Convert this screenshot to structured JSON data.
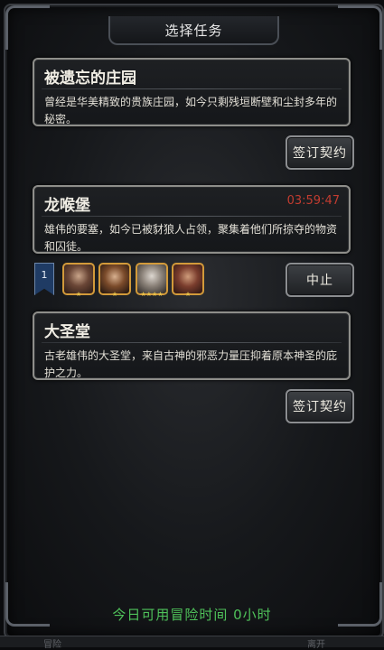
{
  "header": {
    "title": "选择任务"
  },
  "quests": [
    {
      "name": "被遗忘的庄园",
      "description": "曾经是华美精致的贵族庄园，如今只剩残垣断壁和尘封多年的秘密。",
      "button": "签订契约"
    },
    {
      "name": "龙喉堡",
      "timer": "03:59:47",
      "description": "雄伟的要塞，如今已被豺狼人占领，聚集着他们所掠夺的物资和囚徒。",
      "button": "中止",
      "party": {
        "rank": "1",
        "heroes": [
          {
            "stars": "★"
          },
          {
            "stars": "★"
          },
          {
            "stars": "★★★★"
          },
          {
            "stars": "★"
          }
        ]
      }
    },
    {
      "name": "大圣堂",
      "description": "古老雄伟的大圣堂，来自古神的邪恶力量压抑着原本神圣的庇护之力。",
      "button": "签订契约"
    }
  ],
  "footer": {
    "text": "今日可用冒险时间 0小时"
  },
  "bottom_tabs": [
    "冒险",
    "",
    "离开"
  ]
}
